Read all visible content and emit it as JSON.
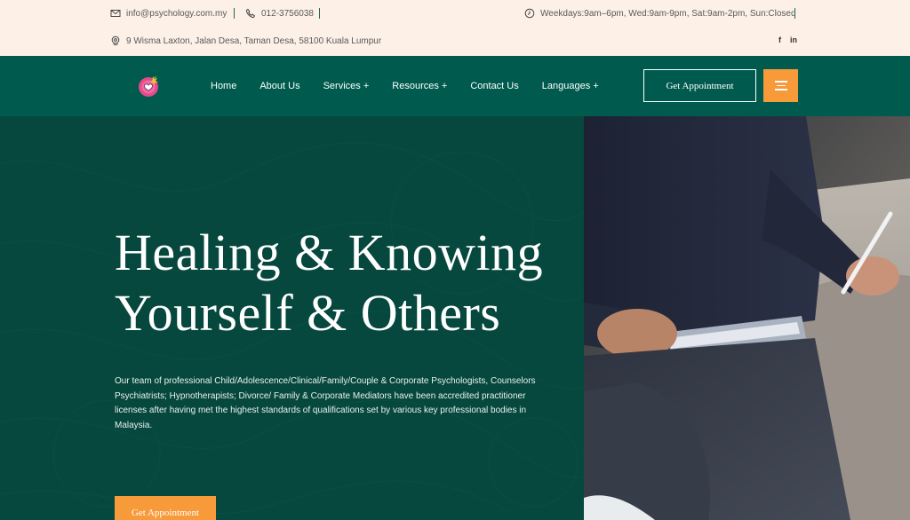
{
  "topbar": {
    "email": "info@psychology.com.my",
    "phone": "012-3756038",
    "hours": "Weekdays:9am–6pm, Wed:9am-9pm, Sat:9am-2pm, Sun:Closed",
    "address": "9 Wisma Laxton, Jalan Desa, Taman Desa, 58100 Kuala Lumpur",
    "social": {
      "facebook": "f",
      "linkedin": "in"
    }
  },
  "nav": {
    "items": [
      {
        "label": "Home"
      },
      {
        "label": "About Us"
      },
      {
        "label": "Services +"
      },
      {
        "label": "Resources +"
      },
      {
        "label": "Contact Us"
      },
      {
        "label": "Languages +"
      }
    ],
    "cta": "Get Appointment",
    "menu_icon": "hamburger-icon"
  },
  "hero": {
    "headline_line1": "Healing & Knowing",
    "headline_line2": "Yourself & Others",
    "description": "Our team of professional Child/Adolescence/Clinical/Family/Couple & Corporate Psychologists, Counselors Psychiatrists; Hypnotherapists; Divorce/ Family & Corporate Mediators have been accredited practitioner licenses after having met the highest standards of qualifications set by various key professional bodies in Malaysia.",
    "cta": "Get Appointment"
  },
  "colors": {
    "topbar_bg": "#fdf0e6",
    "nav_bg": "#005b4e",
    "hero_bg": "#06483e",
    "accent": "#f79a3a"
  }
}
